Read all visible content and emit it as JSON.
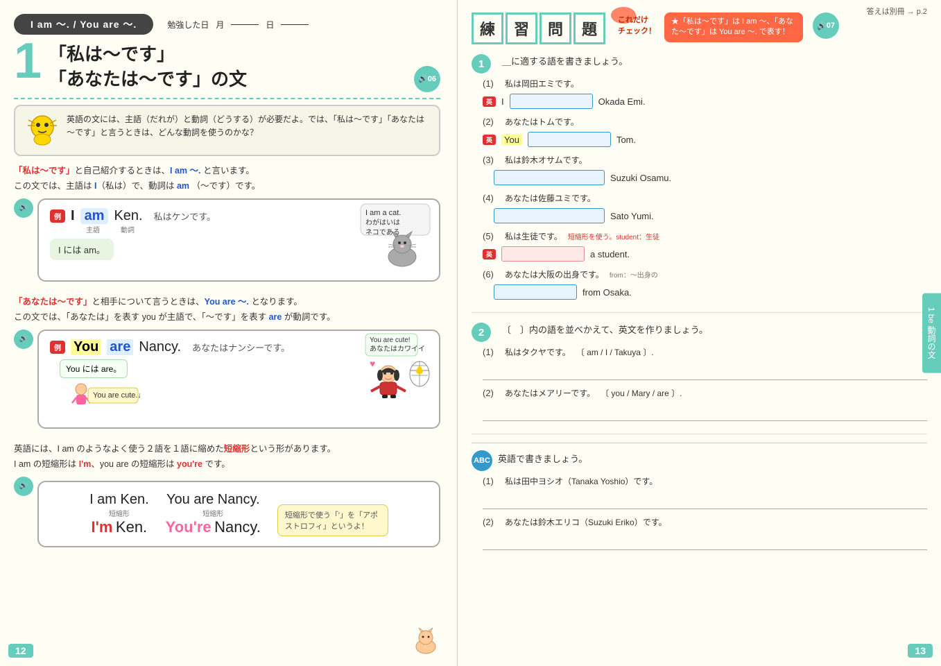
{
  "leftPage": {
    "pageNumber": "12",
    "header": {
      "banner": "I am ～. / You are ～.",
      "studyDate": "勉強した日",
      "month": "月",
      "day": "日"
    },
    "lessonNumber": "1",
    "lessonTitle1": "「私は～です」",
    "lessonTitle2": "「あなたは～です」の文",
    "audioNum": "06",
    "speechBubble": "英語の文には、主語（だれが）と動詞（どうする）が必要だよ。では、「私は～です」「あなたは～です」と言うときは、どんな動詞を使うのかな？",
    "iamExplanation1": "「私は～です」と自己紹介するときは、",
    "iamExplanation2": " I am ～.",
    "iamExplanation3": " と言います。",
    "iamExplanation4": "この文では、主語は I（私は）で、動詞は",
    "iamExplanation5": " am ",
    "iamExplanation6": "（～です）です。",
    "iamExample": {
      "badge": "例",
      "subject": "I",
      "verb": "am",
      "rest": "Ken.",
      "translation": "私はケンです。",
      "subjectLabel": "主語",
      "verbLabel": "動詞",
      "note": "I には am。",
      "catSpeech1": "I am a cat.",
      "catSpeech2": "わがはいは",
      "catSpeech3": "ネコである"
    },
    "youExplanation1": "「あなたは～です」と相手について言うときは、",
    "youExplanation2": " You are ～.",
    "youExplanation3": " となります。",
    "youExplanation4": "この文では、「あなたは」を表す you が主語で、「～です」を表す",
    "youExplanation5": " are ",
    "youExplanation6": "が動詞です。",
    "youExample": {
      "badge": "例",
      "you": "You",
      "are": "are",
      "rest": "Nancy.",
      "translation": "あなたはナンシーです。",
      "speech1": "You are cute!",
      "speech2": "あなたはカワイイ",
      "note": "You には are。",
      "subText": "You are cute.↓"
    },
    "contractionIntro": "英語には、I am のようなよく使う２語を１語に縮めた",
    "contractionWord": "短縮形",
    "contractionIntro2": "という形があります。",
    "contractionDetail": "I am の短縮形は",
    "im": "I'm",
    "contractionDetail2": "、you are の短縮形は",
    "youre": "you're",
    "contractionDetail3": " です。",
    "contractionBox": {
      "left": {
        "original": "I am Ken.",
        "label": "短縮形",
        "contracted": "I'm",
        "contractedRest": " Ken."
      },
      "right": {
        "original": "You are Nancy.",
        "label": "短縮形",
        "contracted": "You're",
        "contractedRest": " Nancy."
      },
      "note": "短縮形で使う「'」を「アポストロフィ」というよ！"
    }
  },
  "rightPage": {
    "pageNumber": "13",
    "refNote": "答えは別冊 → p.2",
    "title": {
      "chars": [
        "練",
        "習",
        "問",
        "題"
      ]
    },
    "checkNote": "★「私は～です」は I am ～、「あなた～です」は You are ～. で表す！",
    "audioNum": "07",
    "sidebarLabel": "1 be 動詞の文",
    "exercise1": {
      "num": "1",
      "instruction": "＿に適する語を書きましょう。",
      "items": [
        {
          "num": "(1)",
          "japanese": "私は岡田エミです。",
          "badge": "英",
          "prefix": "I",
          "suffix": "Okada Emi."
        },
        {
          "num": "(2)",
          "japanese": "あなたはトムです。",
          "badge": "英",
          "prefix": "You",
          "suffix": "Tom."
        },
        {
          "num": "(3)",
          "japanese": "私は鈴木オサムです。",
          "suffix": "Suzuki Osamu."
        },
        {
          "num": "(4)",
          "japanese": "あなたは佐藤ユミです。",
          "suffix": "Sato Yumi."
        },
        {
          "num": "(5)",
          "japanese": "私は生徒です。",
          "vocabNote": "短縮形を使う。student：生徒",
          "badge": "英",
          "suffix": "a student."
        },
        {
          "num": "(6)",
          "japanese": "あなたは大阪の出身です。",
          "vocabNote": "from：〜出身の",
          "suffix": "from Osaka."
        }
      ]
    },
    "exercise2": {
      "num": "2",
      "instruction": "〔　〕内の語を並べかえて、英文を作りましょう。",
      "items": [
        {
          "num": "(1)",
          "japanese": "私はタクヤです。",
          "words": "〔 am / I / Takuya 〕."
        },
        {
          "num": "(2)",
          "japanese": "あなたはメアリーです。",
          "words": "〔 you / Mary / are 〕."
        }
      ]
    },
    "exercise3": {
      "label": "英語で書きましょう。",
      "items": [
        {
          "num": "(1)",
          "japanese": "私は田中ヨシオ（Tanaka Yoshio）です。"
        },
        {
          "num": "(2)",
          "japanese": "あなたは鈴木エリコ（Suzuki Eriko）です。"
        }
      ]
    }
  }
}
